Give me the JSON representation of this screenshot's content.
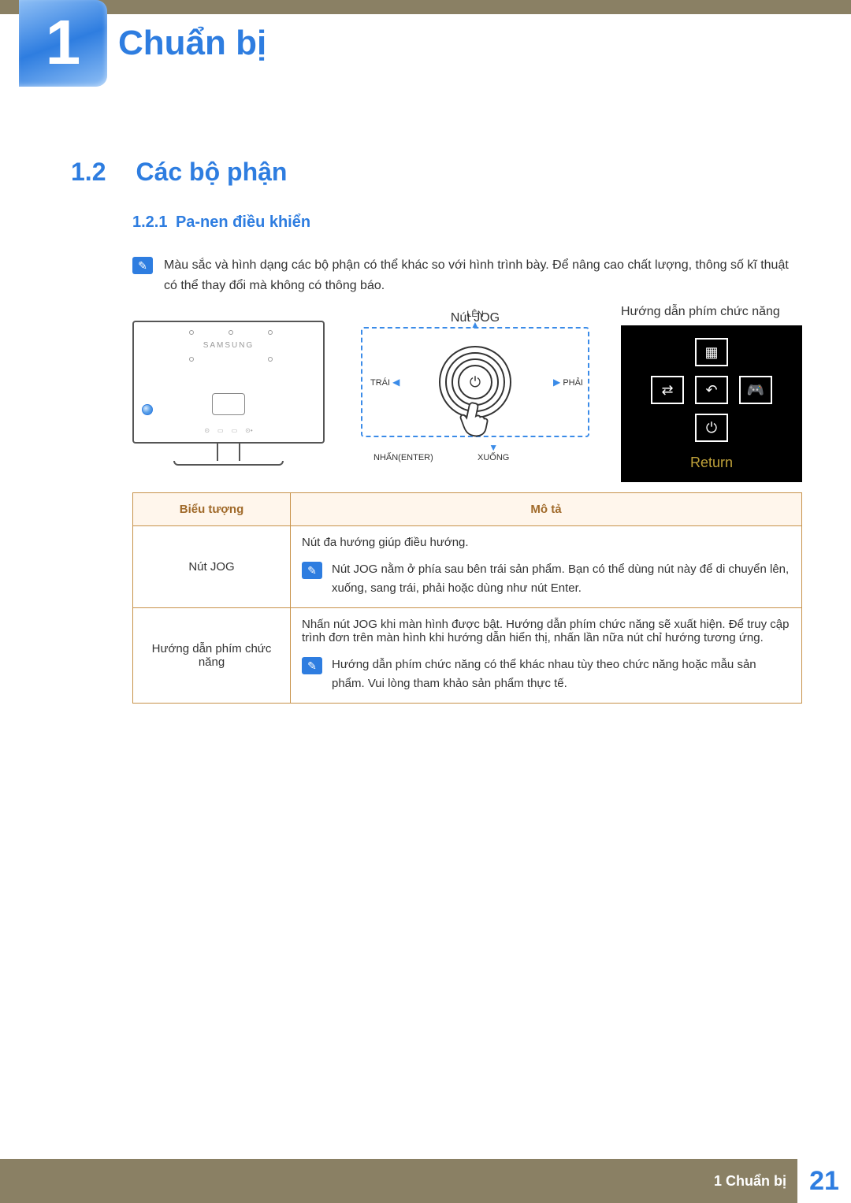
{
  "chapter": {
    "number": "1",
    "title": "Chuẩn bị"
  },
  "section": {
    "number": "1.2",
    "title": "Các bộ phận"
  },
  "subsection": {
    "number": "1.2.1",
    "title": "Pa-nen điều khiển"
  },
  "intro_note": "Màu sắc và hình dạng các bộ phận có thể khác so với hình trình bày. Để nâng cao chất lượng, thông số kĩ thuật có thể thay đổi mà không có thông báo.",
  "diagram": {
    "monitor_brand": "SAMSUNG",
    "jog": {
      "title": "Nút JOG",
      "labels": {
        "up": "LÊN",
        "down": "XUỐNG",
        "left": "TRÁI",
        "right": "PHẢI",
        "enter": "NHẤN(ENTER)"
      }
    },
    "function_key_guide": {
      "title": "Hướng dẫn phím  chức năng",
      "return_label": "Return",
      "icons": {
        "top": "menu-grid-icon",
        "left": "pip-icon",
        "center": "undo-icon",
        "right": "game-icon",
        "bottom": "power-icon"
      }
    }
  },
  "table": {
    "headers": {
      "icon": "Biểu tượng",
      "desc": "Mô tả"
    },
    "rows": [
      {
        "icon_label": "Nút JOG",
        "desc_main": "Nút đa hướng giúp điều hướng.",
        "desc_note": "Nút JOG nằm ở phía sau bên trái sản phẩm. Bạn có thể dùng nút này để di chuyển lên, xuống, sang trái, phải hoặc dùng như nút Enter."
      },
      {
        "icon_label": "Hướng dẫn phím chức năng",
        "desc_main": "Nhấn nút JOG khi màn hình được bật. Hướng dẫn phím chức năng sẽ xuất hiện. Để truy cập trình đơn trên màn hình khi hướng dẫn hiển thị, nhấn lần nữa nút chỉ hướng tương ứng.",
        "desc_note": "Hướng dẫn phím chức năng có thể khác nhau tùy theo chức năng hoặc mẫu sản phẩm. Vui lòng tham khảo sản phẩm thực tế."
      }
    ]
  },
  "footer": {
    "label": "1 Chuẩn bị",
    "page": "21"
  }
}
